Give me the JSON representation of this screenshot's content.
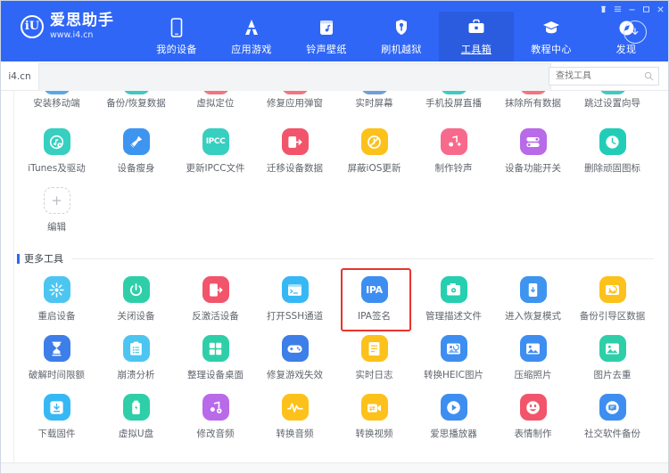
{
  "window": {
    "controls": [
      {
        "name": "skin-icon",
        "glyph": "skin"
      },
      {
        "name": "menu-icon",
        "glyph": "menu"
      },
      {
        "name": "minimize-icon",
        "glyph": "minimize"
      },
      {
        "name": "maximize-icon",
        "glyph": "maximize"
      },
      {
        "name": "close-icon",
        "glyph": "close"
      }
    ]
  },
  "header": {
    "brand_mark": "iU",
    "brand_name": "爱思助手",
    "brand_url": "www.i4.cn",
    "nav": [
      {
        "label": "我的设备",
        "icon": "phone-icon",
        "active": false
      },
      {
        "label": "应用游戏",
        "icon": "apps-icon",
        "active": false
      },
      {
        "label": "铃声壁纸",
        "icon": "music-box-icon",
        "active": false
      },
      {
        "label": "刷机越狱",
        "icon": "key-shield-icon",
        "active": false
      },
      {
        "label": "工具箱",
        "icon": "toolbox-icon",
        "active": true
      },
      {
        "label": "教程中心",
        "icon": "graduation-cap-icon",
        "active": false
      },
      {
        "label": "发现",
        "icon": "compass-icon",
        "active": false
      }
    ],
    "download_icon": "download-arrow-icon"
  },
  "subbar": {
    "site_label": "i4.cn",
    "search_placeholder": "查找工具",
    "search_value": "",
    "search_icon": "search-icon"
  },
  "tools_top": {
    "row1": [
      {
        "label": "安装移动端",
        "color": "#5aa7e8",
        "icon": "download-mobile-icon"
      },
      {
        "label": "备份/恢复数据",
        "color": "#3fc9c0",
        "icon": "backup-icon"
      },
      {
        "label": "虚拟定位",
        "color": "#f2757f",
        "icon": "location-icon"
      },
      {
        "label": "修复应用弹窗",
        "color": "#f2757f",
        "icon": "popup-fix-icon"
      },
      {
        "label": "实时屏幕",
        "color": "#6f9fd8",
        "icon": "screen-icon"
      },
      {
        "label": "手机投屏直播",
        "color": "#3fc9c0",
        "icon": "cast-icon"
      },
      {
        "label": "抹除所有数据",
        "color": "#f2757f",
        "icon": "erase-icon"
      },
      {
        "label": "跳过设置向导",
        "color": "#3fc9c0",
        "icon": "skip-setup-icon"
      }
    ],
    "row2": [
      {
        "label": "iTunes及驱动",
        "color": "#36cfc0",
        "icon": "itunes-gear-icon"
      },
      {
        "label": "设备瘦身",
        "color": "#3d95f0",
        "icon": "broom-icon"
      },
      {
        "label": "更新IPCC文件",
        "color": "#36cfc0",
        "icon": "ipcc-text-icon"
      },
      {
        "label": "迁移设备数据",
        "color": "#f2556b",
        "icon": "migrate-icon"
      },
      {
        "label": "屏蔽iOS更新",
        "color": "#fcc21b",
        "icon": "block-update-icon"
      },
      {
        "label": "制作铃声",
        "color": "#f76a8c",
        "icon": "ringtone-icon"
      },
      {
        "label": "设备功能开关",
        "color": "#b86ae8",
        "icon": "toggles-icon"
      },
      {
        "label": "删除顽固图标",
        "color": "#22cdb8",
        "icon": "clock-icon"
      }
    ],
    "edit": {
      "label": "编辑",
      "icon": "plus-icon"
    }
  },
  "more_tools": {
    "title": "更多工具",
    "items": [
      {
        "label": "重启设备",
        "color": "#4cc6f0",
        "icon": "restart-icon"
      },
      {
        "label": "关闭设备",
        "color": "#2ecfa8",
        "icon": "power-icon"
      },
      {
        "label": "反激活设备",
        "color": "#f2556b",
        "icon": "deactivate-icon"
      },
      {
        "label": "打开SSH通道",
        "color": "#36b8f5",
        "icon": "terminal-icon"
      },
      {
        "label": "IPA签名",
        "color": "#3d8ef0",
        "icon": "ipa-text-icon",
        "highlighted": true
      },
      {
        "label": "管理描述文件",
        "color": "#25cfb0",
        "icon": "profile-gear-icon"
      },
      {
        "label": "进入恢复模式",
        "color": "#3d95f0",
        "icon": "recovery-icon"
      },
      {
        "label": "备份引导区数据",
        "color": "#fcc21b",
        "icon": "boot-backup-icon"
      },
      {
        "label": "破解时间限额",
        "color": "#3d7ee8",
        "icon": "hourglass-icon"
      },
      {
        "label": "崩溃分析",
        "color": "#4cc6f0",
        "icon": "clipboard-icon"
      },
      {
        "label": "整理设备桌面",
        "color": "#2ecfa8",
        "icon": "grid-icon"
      },
      {
        "label": "修复游戏失效",
        "color": "#3d7ee8",
        "icon": "gamepad-icon"
      },
      {
        "label": "实时日志",
        "color": "#fcc21b",
        "icon": "log-icon"
      },
      {
        "label": "转换HEIC图片",
        "color": "#3d8ef0",
        "icon": "heic-convert-icon"
      },
      {
        "label": "压缩照片",
        "color": "#3d8ef0",
        "icon": "photo-icon"
      },
      {
        "label": "图片去重",
        "color": "#2ecfa8",
        "icon": "dedupe-icon"
      },
      {
        "label": "下载固件",
        "color": "#36b8f5",
        "icon": "firmware-download-icon"
      },
      {
        "label": "虚拟U盘",
        "color": "#2ecfa8",
        "icon": "usb-icon"
      },
      {
        "label": "修改音频",
        "color": "#b86ae8",
        "icon": "audio-edit-icon"
      },
      {
        "label": "转换音频",
        "color": "#fcc21b",
        "icon": "waveform-icon"
      },
      {
        "label": "转换视频",
        "color": "#fcc21b",
        "icon": "video-convert-icon"
      },
      {
        "label": "爱思播放器",
        "color": "#3d8ef0",
        "icon": "play-icon"
      },
      {
        "label": "表情制作",
        "color": "#f2556b",
        "icon": "emoji-icon"
      },
      {
        "label": "社交软件备份",
        "color": "#3d8ef0",
        "icon": "chat-backup-icon"
      }
    ]
  }
}
